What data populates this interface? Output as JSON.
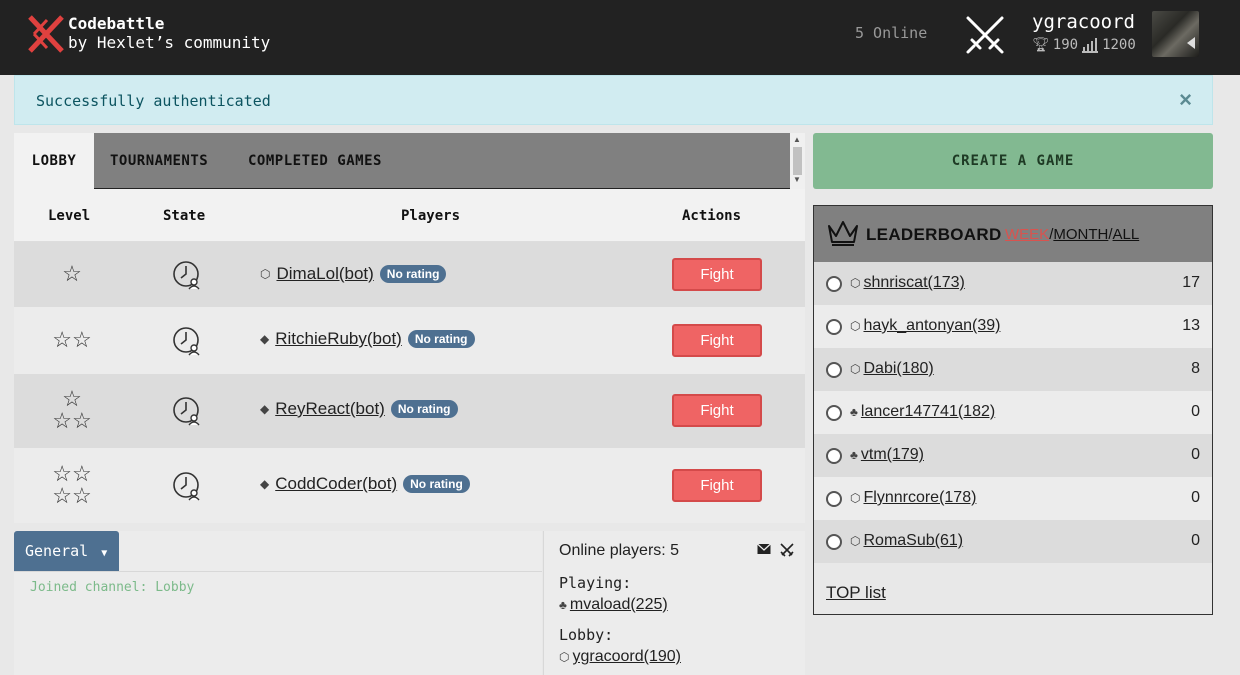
{
  "header": {
    "brand_line1": "Codebattle",
    "brand_line2": "by Hexlet’s community",
    "online": "5 Online",
    "username": "ygracoord",
    "rating": "190",
    "elo": "1200"
  },
  "alert": {
    "message": "Successfully authenticated",
    "close": "×"
  },
  "tabs": [
    {
      "label": "LOBBY"
    },
    {
      "label": "TOURNAMENTS"
    },
    {
      "label": "COMPLETED GAMES"
    }
  ],
  "games_table": {
    "headers": [
      "Level",
      "State",
      "Players",
      "Actions"
    ],
    "rows": [
      {
        "level_stars": 1,
        "player": "DimaLol(bot)",
        "lang": "php",
        "rating_badge": "No rating",
        "action": "Fight"
      },
      {
        "level_stars": 2,
        "player": "RitchieRuby(bot)",
        "lang": "ruby",
        "rating_badge": "No rating",
        "action": "Fight"
      },
      {
        "level_stars": 3,
        "player": "ReyReact(bot)",
        "lang": "ruby",
        "rating_badge": "No rating",
        "action": "Fight"
      },
      {
        "level_stars": 4,
        "player": "CoddCoder(bot)",
        "lang": "ruby",
        "rating_badge": "No rating",
        "action": "Fight"
      }
    ]
  },
  "create_game": {
    "label": "CREATE A GAME"
  },
  "leaderboard": {
    "title": "LEADERBOARD",
    "filters": [
      "WEEK",
      "MONTH",
      "ALL"
    ],
    "active_filter": "WEEK",
    "rows": [
      {
        "name": "shnriscat(173)",
        "lang": "php",
        "score": "17"
      },
      {
        "name": "hayk_antonyan(39)",
        "lang": "php",
        "score": "13"
      },
      {
        "name": "Dabi(180)",
        "lang": "php",
        "score": "8"
      },
      {
        "name": "lancer147741(182)",
        "lang": "python",
        "score": "0"
      },
      {
        "name": "vtm(179)",
        "lang": "python",
        "score": "0"
      },
      {
        "name": "Flynnrcore(178)",
        "lang": "php",
        "score": "0"
      },
      {
        "name": "RomaSub(61)",
        "lang": "php",
        "score": "0"
      }
    ],
    "top_list": "TOP list"
  },
  "chat": {
    "channel": "General",
    "message": "Joined channel: Lobby"
  },
  "online_players": {
    "title": "Online players: 5",
    "playing_label": "Playing:",
    "playing_user": "mvaload(225)",
    "lobby_label": "Lobby:",
    "lobby_user": "ygracoord(190)"
  },
  "colors": {
    "header_bg": "#222222",
    "fight": "#ef6464",
    "create": "#82b991",
    "badge": "#4e7091",
    "alert_bg": "#d1ecf1"
  }
}
